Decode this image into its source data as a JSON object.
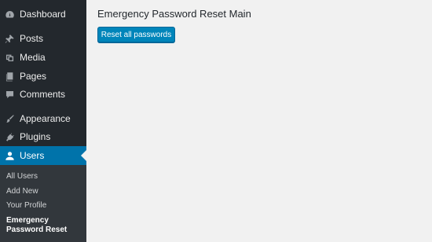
{
  "sidebar": {
    "items": [
      {
        "label": "Dashboard",
        "icon": "dashboard-icon"
      },
      {
        "label": "Posts",
        "icon": "pin-icon"
      },
      {
        "label": "Media",
        "icon": "media-icon"
      },
      {
        "label": "Pages",
        "icon": "pages-icon"
      },
      {
        "label": "Comments",
        "icon": "comment-icon"
      },
      {
        "label": "Appearance",
        "icon": "paintbrush-icon"
      },
      {
        "label": "Plugins",
        "icon": "plugin-icon"
      },
      {
        "label": "Users",
        "icon": "user-icon",
        "active": true
      }
    ],
    "submenu": [
      "All Users",
      "Add New",
      "Your Profile",
      "Emergency Password Reset"
    ]
  },
  "main": {
    "title": "Emergency Password Reset Main",
    "reset_button": "Reset all passwords"
  },
  "colors": {
    "sidebar_bg": "#23282d",
    "submenu_bg": "#32373c",
    "active_bg": "#0073aa",
    "button_bg": "#0085ba",
    "page_bg": "#f1f1f1"
  }
}
